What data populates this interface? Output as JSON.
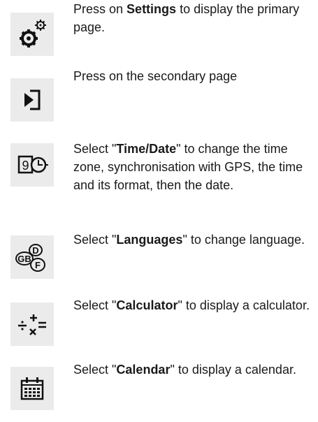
{
  "items": [
    {
      "icon": "settings-gears-icon",
      "pre": "Press on ",
      "bold": "Settings",
      "post": " to display the primary page."
    },
    {
      "icon": "next-page-icon",
      "pre": "Press on the secondary page",
      "bold": "",
      "post": ""
    },
    {
      "icon": "time-date-icon",
      "pre": "Select \"",
      "bold": "Time/Date",
      "post": "\" to change the time zone, synchronisation with GPS, the time and its format, then the date."
    },
    {
      "icon": "languages-icon",
      "pre": "Select \"",
      "bold": "Languages",
      "post": "\" to change language."
    },
    {
      "icon": "calculator-icon",
      "pre": "Select \"",
      "bold": "Calculator",
      "post": "\" to display a calculator."
    },
    {
      "icon": "calendar-icon",
      "pre": "Select \"",
      "bold": "Calendar",
      "post": "\" to display a calendar."
    }
  ],
  "icon_labels": {
    "languages": [
      "GB",
      "D",
      "F"
    ],
    "time_digit": "9"
  }
}
